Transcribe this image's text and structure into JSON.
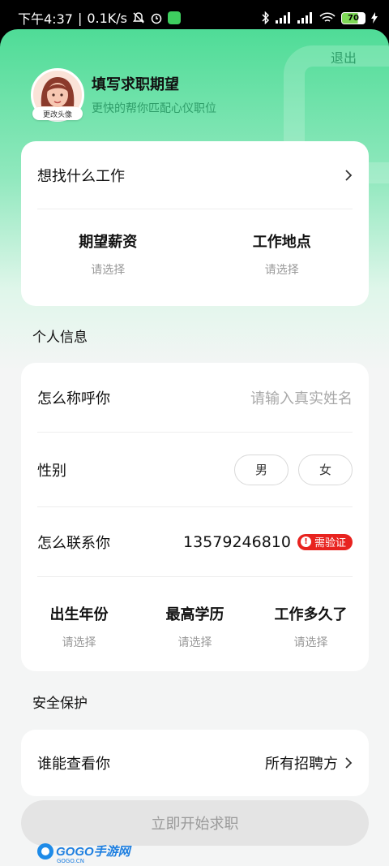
{
  "status_bar": {
    "time": "下午4:37",
    "speed": "0.1K/s",
    "battery": "70"
  },
  "header": {
    "logout": "退出",
    "avatar_badge": "更改头像",
    "title": "填写求职期望",
    "subtitle": "更快的帮你匹配心仪职位"
  },
  "expectation": {
    "job_label": "想找什么工作",
    "salary_label": "期望薪资",
    "salary_value": "请选择",
    "location_label": "工作地点",
    "location_value": "请选择"
  },
  "personal": {
    "section_title": "个人信息",
    "name_label": "怎么称呼你",
    "name_placeholder": "请输入真实姓名",
    "gender_label": "性别",
    "gender_options": [
      "男",
      "女"
    ],
    "contact_label": "怎么联系你",
    "phone": "13579246810",
    "verify_badge": "需验证",
    "verify_icon": "!",
    "birth_label": "出生年份",
    "birth_value": "请选择",
    "education_label": "最高学历",
    "education_value": "请选择",
    "experience_label": "工作多久了",
    "experience_value": "请选择"
  },
  "security": {
    "section_title": "安全保护",
    "visibility_label": "谁能查看你",
    "visibility_value": "所有招聘方"
  },
  "footer": {
    "start_button": "立即开始求职",
    "watermark": "GOGO手游网",
    "watermark_sub": "GOGO.CN"
  },
  "icons": {
    "chevron": "chevron-right-icon",
    "mute": "bell-off-icon",
    "alarm": "alarm-icon",
    "bluetooth": "bluetooth-icon",
    "wifi": "wifi-icon"
  },
  "colors": {
    "brand_green": "#4fdc97",
    "accent_text": "#2f9e6a",
    "warning_red": "#e8231f"
  }
}
